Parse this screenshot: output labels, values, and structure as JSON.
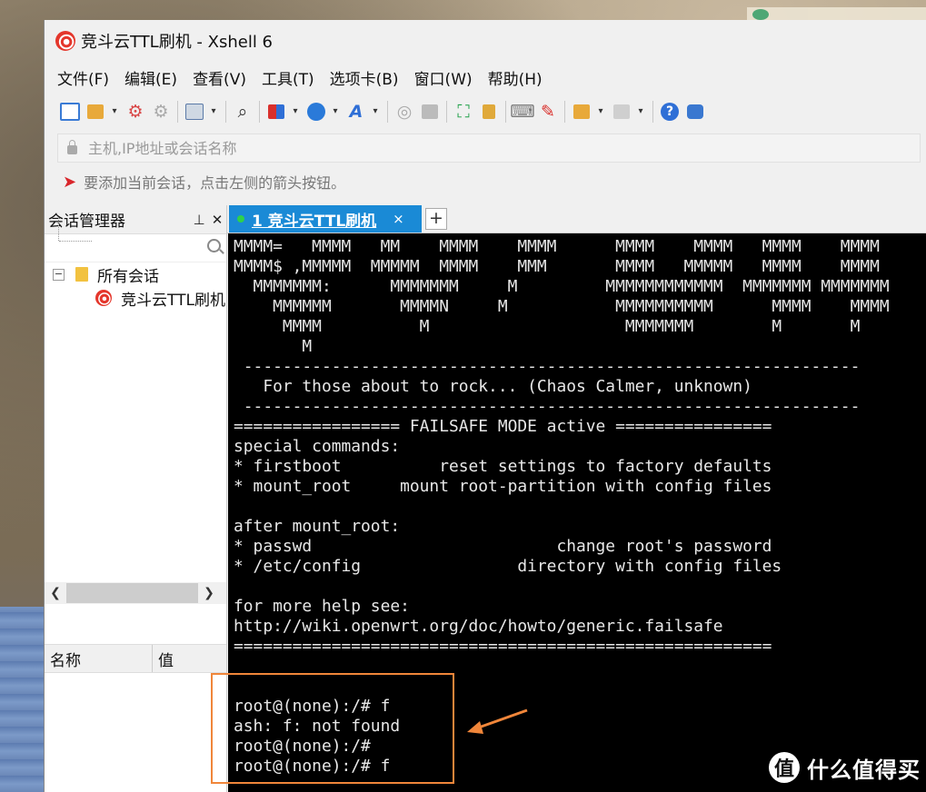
{
  "window": {
    "title": "竞斗云TTL刷机 - Xshell 6"
  },
  "menu": [
    "文件(F)",
    "编辑(E)",
    "查看(V)",
    "工具(T)",
    "选项卡(B)",
    "窗口(W)",
    "帮助(H)"
  ],
  "toolbar_icons": [
    "new-session-icon",
    "open-folder-icon",
    "connect-icon",
    "disconnect-icon",
    "properties-icon",
    "find-icon",
    "transfer-icon",
    "globe-icon",
    "font-icon",
    "xftp-icon",
    "screenshot-icon",
    "fullscreen-icon",
    "lock-icon",
    "keyboard-icon",
    "highlight-icon",
    "new-folder-icon",
    "layout-icon",
    "help-icon",
    "chat-icon"
  ],
  "address": {
    "placeholder": "主机,IP地址或会话名称"
  },
  "hint": {
    "text": "要添加当前会话，点击左侧的箭头按钮。"
  },
  "session_manager": {
    "title": "会话管理器",
    "pin": "📌",
    "close": "✕",
    "tree": [
      {
        "label": "所有会话",
        "toggle": "−"
      },
      {
        "label": "竞斗云TTL刷机"
      }
    ],
    "properties": {
      "col_name": "名称",
      "col_value": "值"
    }
  },
  "tabs": [
    {
      "label": "1 竞斗云TTL刷机",
      "close": "×"
    }
  ],
  "new_tab": "+",
  "terminal": {
    "lines": [
      "MMMM=   MMMM   MM    MMMM    MMMM      MMMM    MMMM   MMMM    MMMM",
      "MMMM$ ,MMMMM  MMMMM  MMMM    MMM       MMMM   MMMMM   MMMM    MMMM",
      "  MMMMMMM:      MMMMMMM     M         MMMMMMMMMMMM  MMMMMMM MMMMMMM",
      "    MMMMMM       MMMMN     M           MMMMMMMMMM      MMMM    MMMM",
      "     MMMM          M                    MMMMMMM        M       M",
      "       M",
      " ---------------------------------------------------------------",
      "   For those about to rock... (Chaos Calmer, unknown)",
      " ---------------------------------------------------------------",
      "================= FAILSAFE MODE active ================",
      "special commands:",
      "* firstboot          reset settings to factory defaults",
      "* mount_root     mount root-partition with config files",
      "",
      "after mount_root:",
      "* passwd                         change root's password",
      "* /etc/config                directory with config files",
      "",
      "for more help see:",
      "http://wiki.openwrt.org/doc/howto/generic.failsafe",
      "=======================================================",
      "",
      "",
      "root@(none):/# f",
      "ash: f: not found",
      "root@(none):/#",
      "root@(none):/# f"
    ]
  },
  "colors": {
    "tab_active": "#1a8ad6",
    "annotation": "#f0863a",
    "terminal_bg": "#000000"
  },
  "watermark": {
    "logo": "值",
    "text": "什么值得买"
  }
}
